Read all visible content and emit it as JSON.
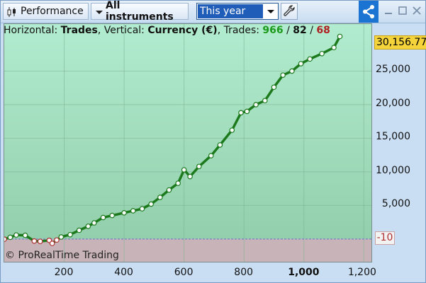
{
  "toolbar": {
    "performance_label": "Performance",
    "instruments_label": "All instruments",
    "period_value": "This year"
  },
  "header": {
    "h_prefix": "Horizontal: ",
    "h_value": "Trades",
    "v_prefix": ", Vertical: ",
    "v_value": "Currency (€)",
    "t_prefix": ", Trades: ",
    "trades_total": "966",
    "sep1": " / ",
    "trades_mid": "82",
    "sep2": " / ",
    "trades_losing": "68"
  },
  "copyright": "© ProRealTime Trading",
  "colors": {
    "accent": "#1b73d2",
    "line": "#1c7a1c",
    "gain_fill": "#a3e0bf",
    "loss_fill": "#c8b3b8",
    "last_badge": "#f4d33b",
    "zero_line": "#6f6fd0"
  },
  "chart_data": {
    "type": "line",
    "xlabel": "",
    "ylabel": "",
    "x_ticks": [
      "200",
      "400",
      "600",
      "800",
      "1,000",
      "1,200"
    ],
    "x_tick_values": [
      200,
      400,
      600,
      800,
      1000,
      1200
    ],
    "y_ticks": [
      "5,000",
      "10,000",
      "15,000",
      "20,000",
      "25,000"
    ],
    "y_tick_values": [
      5000,
      10000,
      15000,
      20000,
      25000
    ],
    "xlim": [
      0,
      1230
    ],
    "ylim": [
      -3600,
      32000
    ],
    "last_value_label": "30,156.77",
    "zero_label": "-10",
    "grid": true,
    "series": [
      {
        "x": [
          0,
          20,
          40,
          70,
          100,
          120,
          150,
          160,
          175,
          190,
          220,
          250,
          280,
          300,
          330,
          360,
          400,
          430,
          460,
          490,
          520,
          550,
          580,
          600,
          620,
          650,
          690,
          720,
          760,
          790,
          810,
          840,
          870,
          900,
          930,
          960,
          990,
          1020,
          1060,
          1100,
          1120
        ],
        "y": [
          -30,
          250,
          600,
          550,
          -300,
          -350,
          -200,
          -650,
          -150,
          300,
          650,
          1300,
          1900,
          2400,
          3200,
          3500,
          3900,
          4200,
          4500,
          5200,
          6200,
          7300,
          8300,
          10300,
          9300,
          10800,
          12400,
          14000,
          16200,
          18800,
          19000,
          20000,
          20600,
          22600,
          24400,
          25000,
          26100,
          26800,
          27600,
          28500,
          30157
        ]
      }
    ]
  }
}
